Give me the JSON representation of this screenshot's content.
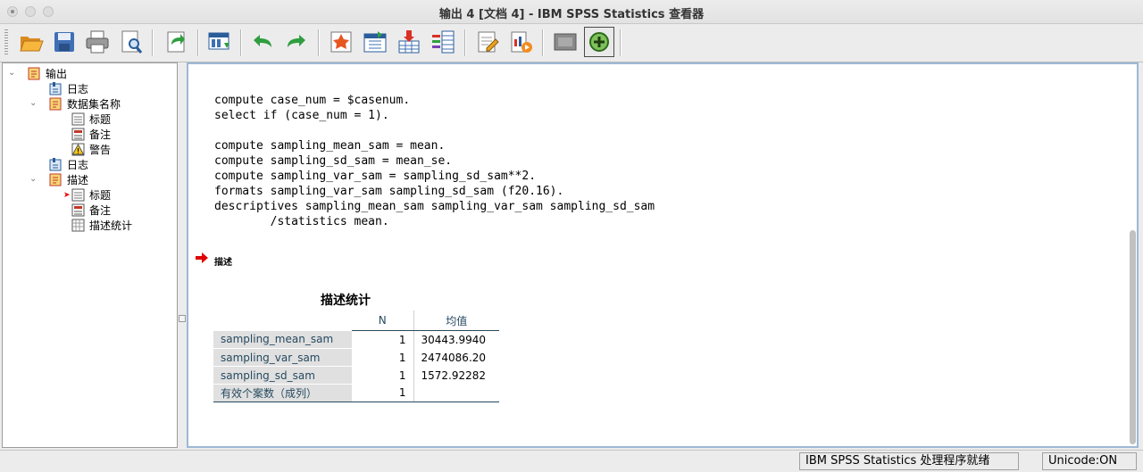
{
  "window": {
    "title": "输出 4 [文档 4] - IBM SPSS Statistics 查看器"
  },
  "toolbar": {
    "buttons": [
      "open-folder-icon",
      "save-icon",
      "print-icon",
      "print-preview-icon",
      "export-icon",
      "goto-data-icon",
      "undo-icon",
      "redo-icon",
      "goto-case-icon",
      "goto-variable-icon",
      "insert-variable-icon",
      "variable-sets-icon",
      "insert-heading-icon",
      "insert-chart-icon",
      "hide-icon",
      "designate-window-icon"
    ]
  },
  "outline": {
    "nodes": [
      {
        "label": "输出",
        "icon": "output-book-icon"
      },
      {
        "label": "日志",
        "icon": "log-icon"
      },
      {
        "label": "数据集名称",
        "icon": "procedure-book-icon"
      },
      {
        "label": "标题",
        "icon": "title-icon"
      },
      {
        "label": "备注",
        "icon": "notes-icon"
      },
      {
        "label": "警告",
        "icon": "warning-icon"
      },
      {
        "label": "日志",
        "icon": "log-icon"
      },
      {
        "label": "描述",
        "icon": "procedure-book-icon"
      },
      {
        "label": "标题",
        "icon": "title-icon"
      },
      {
        "label": "备注",
        "icon": "notes-icon"
      },
      {
        "label": "描述统计",
        "icon": "table-icon"
      }
    ]
  },
  "content": {
    "syntax": "compute case_num = $casenum.\nselect if (case_num = 1).\n\ncompute sampling_mean_sam = mean.\ncompute sampling_sd_sam = mean_se.\ncompute sampling_var_sam = sampling_sd_sam**2.\nformats sampling_var_sam sampling_sd_sam (f20.16).\ndescriptives sampling_mean_sam sampling_var_sam sampling_sd_sam\n        /statistics mean.",
    "section_heading": "描述",
    "table": {
      "title": "描述统计",
      "col_n": "N",
      "col_mean": "均值",
      "rows": [
        {
          "label": "sampling_mean_sam",
          "n": "1",
          "mean": "30443.9940"
        },
        {
          "label": "sampling_var_sam",
          "n": "1",
          "mean": "2474086.20"
        },
        {
          "label": "sampling_sd_sam",
          "n": "1",
          "mean": "1572.92282"
        },
        {
          "label": "有效个案数（成列）",
          "n": "1",
          "mean": ""
        }
      ]
    }
  },
  "status": {
    "processor": "IBM SPSS Statistics 处理程序就绪",
    "unicode": "Unicode:ON"
  }
}
